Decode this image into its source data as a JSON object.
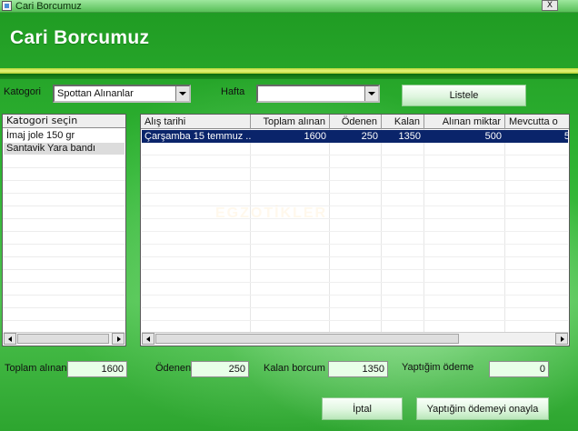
{
  "window": {
    "title": "Cari Borcumuz",
    "close_glyph": "X"
  },
  "header": {
    "title": "Cari Borcumuz"
  },
  "filters": {
    "category_label": "Katogori",
    "category_value": "Spottan Alınanlar",
    "week_label": "Hafta",
    "week_value": "",
    "list_button": "Listele"
  },
  "category_list": {
    "header": "Katogori seçin",
    "items": [
      {
        "label": "İmaj jole 150 gr",
        "selected": false
      },
      {
        "label": "Santavik Yara bandı",
        "selected": true
      }
    ]
  },
  "purchase_table": {
    "columns": [
      "Alış tarihi",
      "Toplam alınan",
      "Ödenen",
      "Kalan",
      "Alınan miktar",
      "Mevcutta o"
    ],
    "rows": [
      [
        "Çarşamba 15 temmuz ...",
        "1600",
        "250",
        "1350",
        "500",
        "5"
      ]
    ]
  },
  "summary": {
    "total_label": "Toplam alınan",
    "total_value": "1600",
    "paid_label": "Ödenen",
    "paid_value": "250",
    "remaining_label": "Kalan borcum",
    "remaining_value": "1350",
    "my_payment_label": "Yaptığim ödeme",
    "my_payment_value": "0"
  },
  "actions": {
    "cancel_button": "İptal",
    "confirm_button": "Yaptığim ödemeyi onayla"
  },
  "watermark": "EGZOTİKLER",
  "colors": {
    "background_green": "#2fb433",
    "selection_navy": "#0a246a",
    "header_stripe_yellow": "#e6f57a"
  }
}
